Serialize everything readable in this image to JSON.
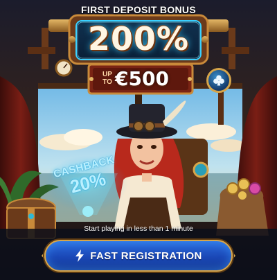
{
  "banner": {
    "heading": "FIRST DEPOSIT BONUS",
    "percent": "200%",
    "up_to_line1": "UP",
    "up_to_line2": "TO",
    "amount": "€500",
    "cashback_label": "CASHBACK",
    "cashback_value": "20%",
    "subtitle": "Start playing in less than 1 minute"
  },
  "cta": {
    "label": "FAST REGISTRATION",
    "icon": "lightning-bolt-icon"
  },
  "icons": {
    "club": "club-suit-icon",
    "chest": "treasure-chest-icon",
    "coins": "coin-sack-icon",
    "gauge": "pressure-gauge-icon"
  },
  "colors": {
    "accent_blue": "#1a47b6",
    "gold_trim": "#d7a64b",
    "plaque_red": "#7a2414",
    "sign_glow": "#3ad0ff"
  }
}
